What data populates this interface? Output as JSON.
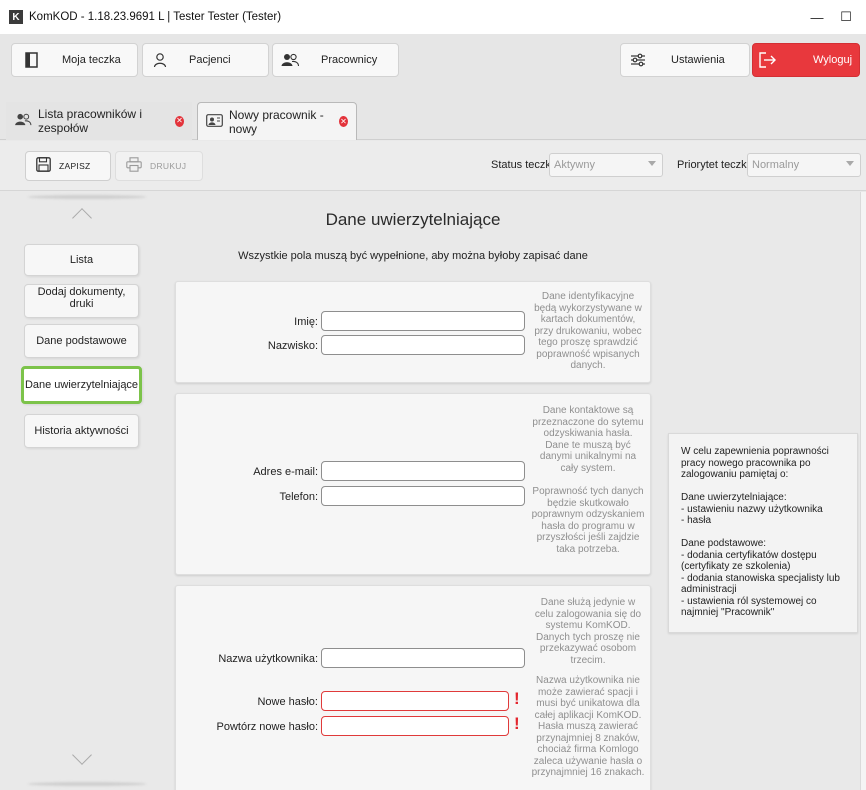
{
  "window": {
    "app_letter": "K",
    "title": "KomKOD - 1.18.23.9691 L | Tester Tester (Tester)",
    "minimize": "—",
    "maximize": "☐"
  },
  "nav": {
    "folder_label": "Moja teczka",
    "patients_label": "Pacjenci",
    "staff_label": "Pracownicy",
    "settings_label": "Ustawienia",
    "logout_label": "Wyloguj"
  },
  "tabs": [
    {
      "label": "Lista pracowników i zespołów"
    },
    {
      "label": "Nowy pracownik - nowy"
    }
  ],
  "toolbar": {
    "save_label": "ZAPISZ",
    "print_label": "DRUKUJ",
    "status_label": "Status teczki",
    "status_value": "Aktywny",
    "priority_label": "Priorytet teczki:",
    "priority_value": "Normalny"
  },
  "sidebar": {
    "items": [
      {
        "label": "Lista"
      },
      {
        "label": "Dodaj dokumenty, druki"
      },
      {
        "label": "Dane podstawowe"
      },
      {
        "label": "Dane uwierzytelniające"
      },
      {
        "label": "Historia aktywności"
      }
    ]
  },
  "main": {
    "title": "Dane uwierzytelniające",
    "subtitle": "Wszystkie pola muszą być wypełnione, aby można byłoby zapisać dane",
    "section1": {
      "first_name_label": "Imię:",
      "first_name_value": "",
      "last_name_label": "Nazwisko:",
      "last_name_value": "",
      "help": "Dane identyfikacyjne będą wykorzystywane w kartach dokumentów, przy drukowaniu, wobec tego proszę sprawdzić poprawność wpisanych danych."
    },
    "section2": {
      "email_label": "Adres e-mail:",
      "email_value": "",
      "phone_label": "Telefon:",
      "phone_value": "",
      "help1": "Dane kontaktowe są przeznaczone do sytemu odzyskiwania hasła. Dane te muszą być danymi unikalnymi na cały system.",
      "help2": "Poprawność tych danych będzie skutkowało poprawnym odzyskaniem hasła do programu w przyszłości jeśli zajdzie taka potrzeba."
    },
    "section3": {
      "username_label": "Nazwa użytkownika:",
      "username_value": "",
      "new_password_label": "Nowe hasło:",
      "new_password_value": "",
      "repeat_password_label": "Powtórz nowe hasło:",
      "repeat_password_value": "",
      "error_mark": "!",
      "help1": "Dane służą jedynie w celu zalogowania się do systemu KomKOD. Danych tych proszę nie przekazywać osobom trzecim.",
      "help2": "Nazwa użytkownika nie może zawierać spacji i musi być unikatowa dla całej aplikacji KomKOD. Hasła muszą zawierać przynajmniej 8 znaków, chociaż firma Komlogo zaleca używanie hasła o przynajmniej 16 znakach."
    }
  },
  "info": {
    "text": "W celu zapewnienia poprawności pracy nowego pracownika po zalogowaniu pamiętaj o:\n\nDane uwierzytelniające:\n- ustawieniu nazwy użytkownika\n- hasła\n\nDane podstawowe:\n- dodania certyfikatów dostępu (certyfikaty ze szkolenia)\n- dodania stanowiska specjalisty lub administracji\n- ustawienia ról systemowej co najmniej \"Pracownik\""
  },
  "colors": {
    "accent_green": "#7cc34a",
    "logout_red": "#e8383d",
    "error_red": "#e3262e"
  }
}
